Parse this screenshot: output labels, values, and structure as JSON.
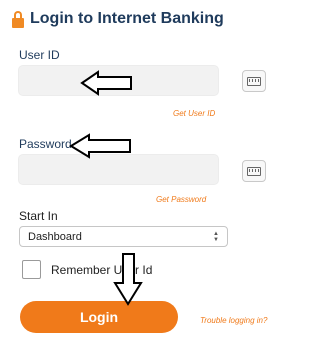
{
  "title": "Login to Internet Banking",
  "user_id": {
    "label": "User ID",
    "value": "",
    "link": "Get User ID"
  },
  "password": {
    "label": "Password",
    "value": "",
    "link": "Get Password"
  },
  "start_in": {
    "label": "Start In",
    "selected": "Dashboard"
  },
  "remember": {
    "label": "Remember User Id",
    "checked": false
  },
  "login_label": "Login",
  "trouble_link": "Trouble logging in?",
  "colors": {
    "accent": "#f07a1a",
    "text": "#1f3b5c",
    "field_bg": "#f2f2f2"
  },
  "icons": {
    "lock": "lock-icon",
    "keyboard": "keyboard-icon"
  }
}
